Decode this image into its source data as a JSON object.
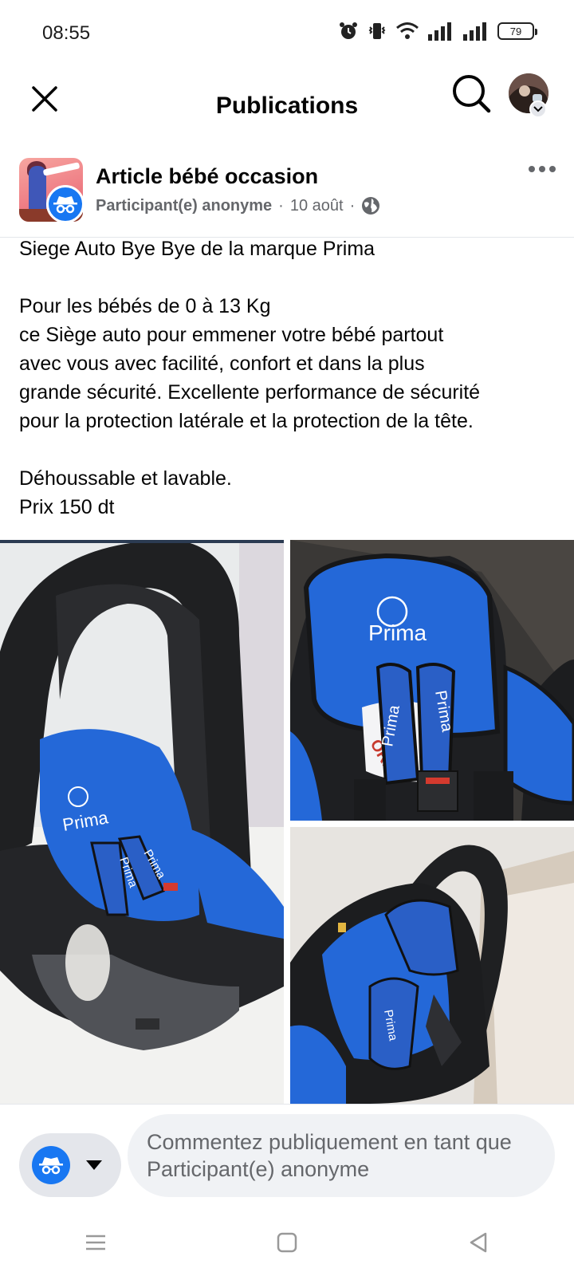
{
  "status_bar": {
    "time": "08:55",
    "battery": "79"
  },
  "header": {
    "title": "Publications"
  },
  "post": {
    "group_name": "Article bébé occasion",
    "author": "Participant(e) anonyme",
    "separator": "·",
    "date": "10 août",
    "body_lines": [
      "Siege Auto Bye Bye de la marque Prima",
      "",
      "Pour les bébés de 0 à 13 Kg",
      "ce Siège auto pour emmener votre bébé partout",
      "avec vous avec facilité, confort et dans la plus",
      "grande sécurité. Excellente performance de sécurité",
      "pour la protection latérale et la protection de la tête.",
      "",
      "Déhoussable et lavable.",
      "Prix 150 dt"
    ],
    "photo_text": {
      "brand_1": "Prima",
      "brand_2": "Prima",
      "brand_3": "Prima",
      "strap_1": "Prima",
      "strap_2": "Prima",
      "strap_3": "Prima",
      "strap_4": "Prima",
      "partial_logo": "ORD"
    }
  },
  "comment": {
    "placeholder": "Commentez publiquement en tant que Participant(e) anonyme"
  },
  "colors": {
    "accent": "#1877f2",
    "seat_blue": "#2468d8",
    "seat_dark": "#1e1f22"
  }
}
